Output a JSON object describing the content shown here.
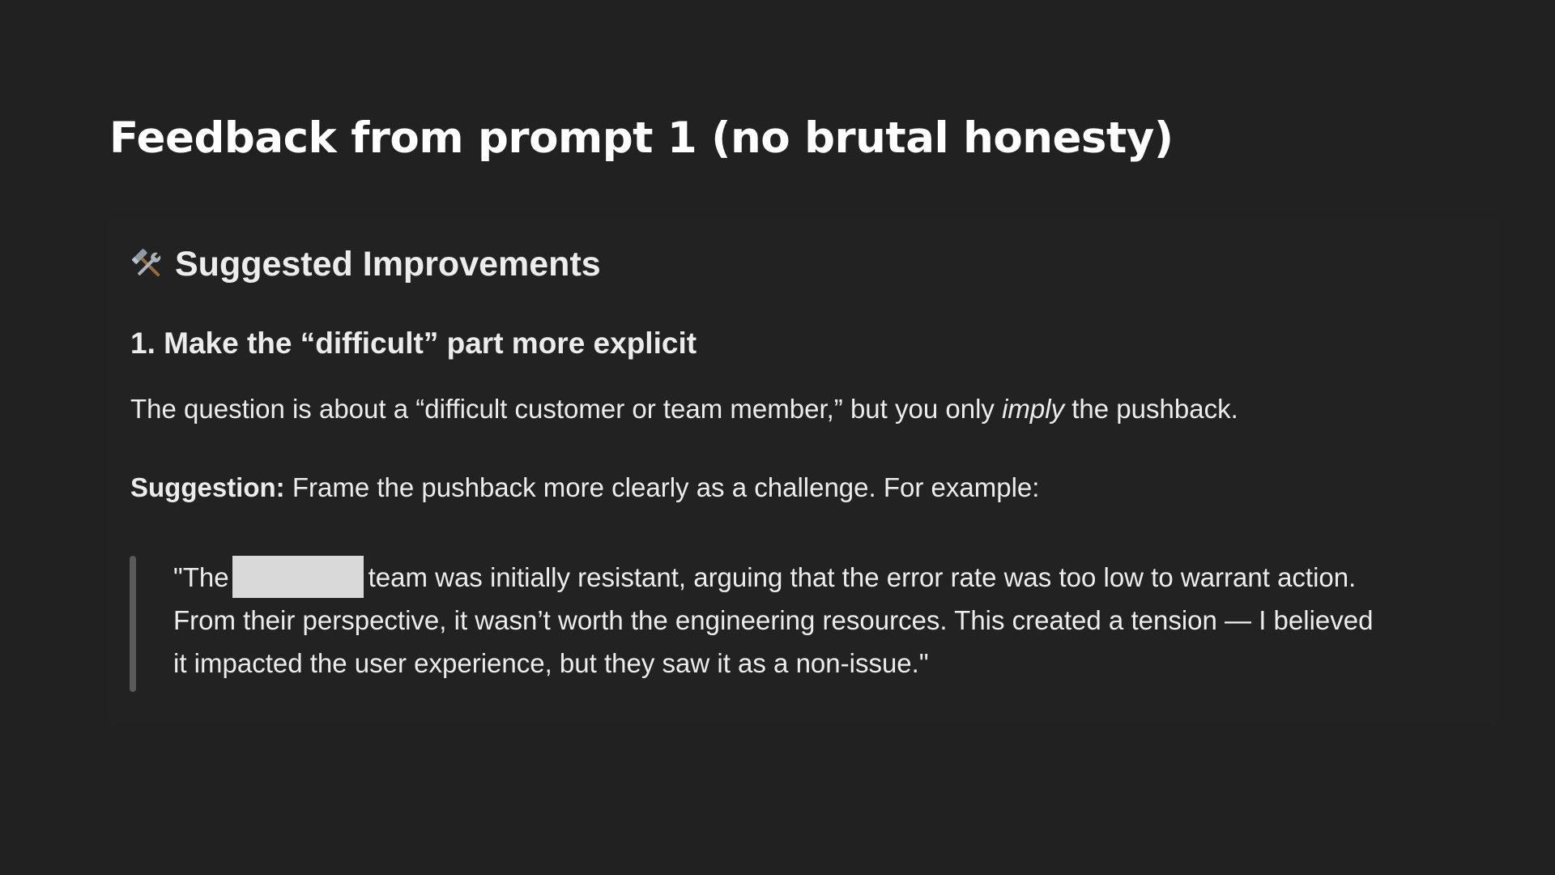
{
  "slide": {
    "title": "Feedback from prompt 1 (no brutal honesty)"
  },
  "card": {
    "section_icon": "hammer-and-wrench-icon",
    "section_heading": "Suggested Improvements",
    "sub_heading": "1. Make the “difficult” part more explicit",
    "paragraph_1": {
      "before": "The question is about a “difficult customer or team member,” but you only ",
      "emphasis": "imply",
      "after": " the pushback."
    },
    "paragraph_2": {
      "label": "Suggestion:",
      "text": " Frame the pushback more clearly as a challenge. For example:"
    },
    "quote": {
      "line_1_before": "\"The",
      "line_1_after": "team was initially resistant, arguing that the error rate was too low to warrant action.",
      "line_2": "From their perspective, it wasn’t worth the engineering resources. This created a tension — I believed",
      "line_3": "it impacted the user experience, but they saw it as a non-issue.\""
    }
  },
  "colors": {
    "background": "#212121",
    "text": "#ececec",
    "quote_bar": "#5a5a5a",
    "redaction": "#d9d9d9"
  }
}
